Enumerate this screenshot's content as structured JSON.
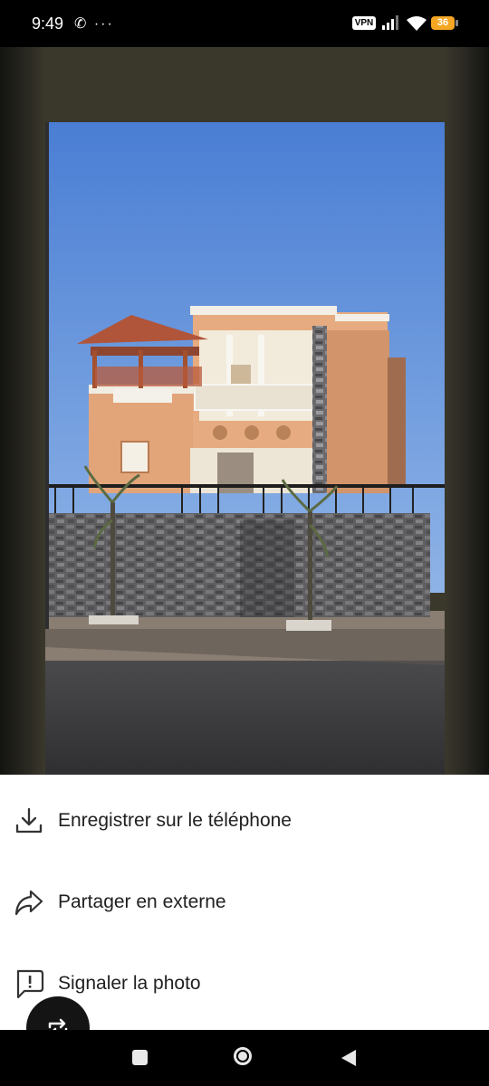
{
  "status_bar": {
    "time": "9:49",
    "left_icons": "✆ ···",
    "vpn": "VPN",
    "battery": "36",
    "battery_color": "#f5a623"
  },
  "photo": {
    "icon": "building-photo"
  },
  "sheet": {
    "items": [
      {
        "label": "Enregistrer sur le téléphone",
        "icon": "download-icon"
      },
      {
        "label": "Partager en externe",
        "icon": "share-icon"
      },
      {
        "label": "Signaler la photo",
        "icon": "report-icon"
      }
    ]
  },
  "fab": {
    "icon": "repost-icon"
  },
  "nav": {
    "icons": [
      "recents-icon",
      "home-icon",
      "back-icon"
    ]
  }
}
